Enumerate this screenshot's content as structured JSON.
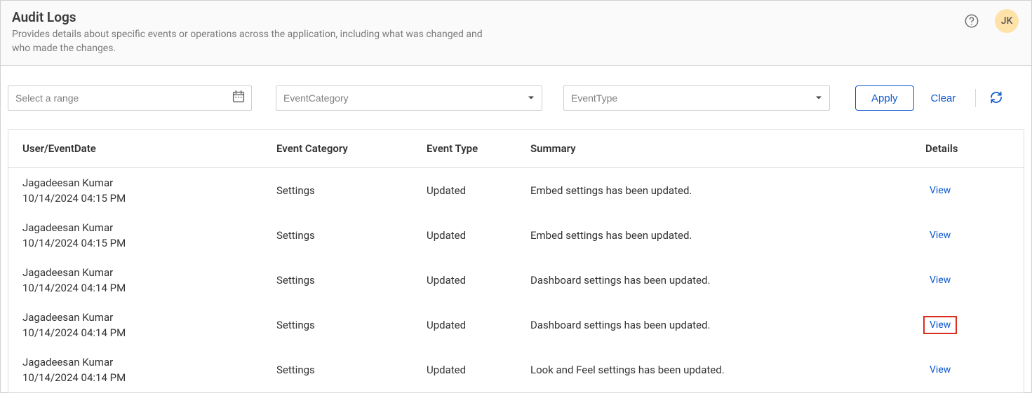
{
  "header": {
    "title": "Audit Logs",
    "description": "Provides details about specific events or operations across the application, including what was changed and who made the changes.",
    "avatar_initials": "JK"
  },
  "filters": {
    "date_placeholder": "Select a range",
    "event_category_placeholder": "EventCategory",
    "event_type_placeholder": "EventType",
    "apply_label": "Apply",
    "clear_label": "Clear"
  },
  "table": {
    "columns": {
      "user": "User/EventDate",
      "category": "Event Category",
      "type": "Event Type",
      "summary": "Summary",
      "details": "Details"
    },
    "view_label": "View",
    "rows": [
      {
        "user": "Jagadeesan Kumar",
        "date": "10/14/2024 04:15 PM",
        "category": "Settings",
        "type": "Updated",
        "summary": "Embed settings has been updated.",
        "highlighted": false
      },
      {
        "user": "Jagadeesan Kumar",
        "date": "10/14/2024 04:15 PM",
        "category": "Settings",
        "type": "Updated",
        "summary": "Embed settings has been updated.",
        "highlighted": false
      },
      {
        "user": "Jagadeesan Kumar",
        "date": "10/14/2024 04:14 PM",
        "category": "Settings",
        "type": "Updated",
        "summary": "Dashboard settings has been updated.",
        "highlighted": false
      },
      {
        "user": "Jagadeesan Kumar",
        "date": "10/14/2024 04:14 PM",
        "category": "Settings",
        "type": "Updated",
        "summary": "Dashboard settings has been updated.",
        "highlighted": true
      },
      {
        "user": "Jagadeesan Kumar",
        "date": "10/14/2024 04:14 PM",
        "category": "Settings",
        "type": "Updated",
        "summary": "Look and Feel settings has been updated.",
        "highlighted": false
      }
    ]
  }
}
